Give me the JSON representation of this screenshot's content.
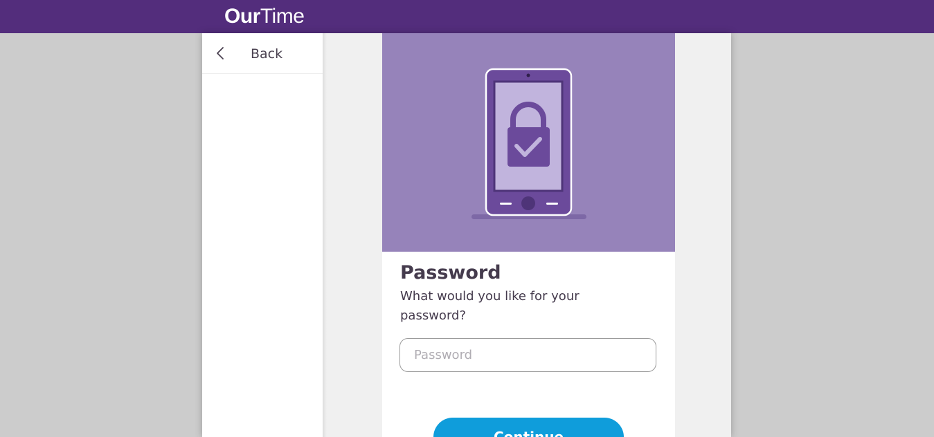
{
  "header": {
    "logo_bold": "Our",
    "logo_light": "Time"
  },
  "sidebar": {
    "back_label": "Back",
    "back_icon": "chevron-left-icon"
  },
  "hero": {
    "icon": "phone-lock-check-icon"
  },
  "form": {
    "title": "Password",
    "subtitle": "What would you like for your password?",
    "password_placeholder": "Password",
    "password_value": "",
    "continue_label": "Continue"
  },
  "colors": {
    "brand_purple": "#532d7c",
    "hero_purple": "#9683ba",
    "accent_blue": "#0f9ddb",
    "text_dark": "#453b4d"
  }
}
